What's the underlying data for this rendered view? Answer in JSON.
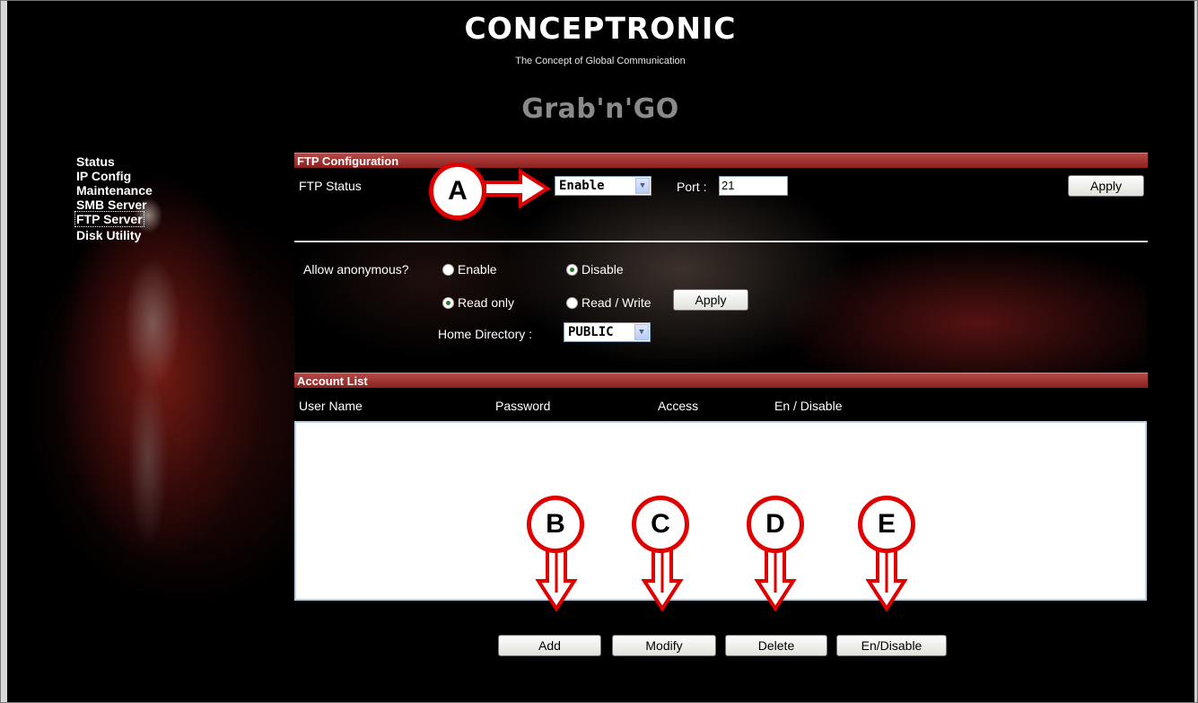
{
  "header": {
    "brand": "CONCEPTRONIC",
    "tagline": "The Concept of Global Communication",
    "product": "Grab'n'GO"
  },
  "sidebar": {
    "items": [
      {
        "label": "Status"
      },
      {
        "label": "IP Config"
      },
      {
        "label": "Maintenance"
      },
      {
        "label": "SMB Server"
      },
      {
        "label": "FTP Server",
        "active": true
      },
      {
        "label": "Disk Utility"
      }
    ]
  },
  "ftp_config": {
    "title": "FTP Configuration",
    "status_label": "FTP Status",
    "status_value": "Enable",
    "port_label": "Port :",
    "port_value": "21",
    "apply_label": "Apply"
  },
  "anonymous": {
    "label": "Allow anonymous?",
    "enable_label": "Enable",
    "disable_label": "Disable",
    "selected": "Disable",
    "read_only_label": "Read only",
    "read_write_label": "Read / Write",
    "access_selected": "Read only",
    "apply_label": "Apply",
    "home_dir_label": "Home Directory :",
    "home_dir_value": "PUBLIC"
  },
  "account_list": {
    "title": "Account List",
    "columns": [
      "User Name",
      "Password",
      "Access",
      "En / Disable"
    ],
    "rows": []
  },
  "actions": {
    "add_label": "Add",
    "modify_label": "Modify",
    "delete_label": "Delete",
    "endisable_label": "En/Disable"
  },
  "callouts": [
    "A",
    "B",
    "C",
    "D",
    "E"
  ],
  "colors": {
    "bar_red": "#9b2a28",
    "callout_red": "#e00000",
    "background": "#000000"
  }
}
